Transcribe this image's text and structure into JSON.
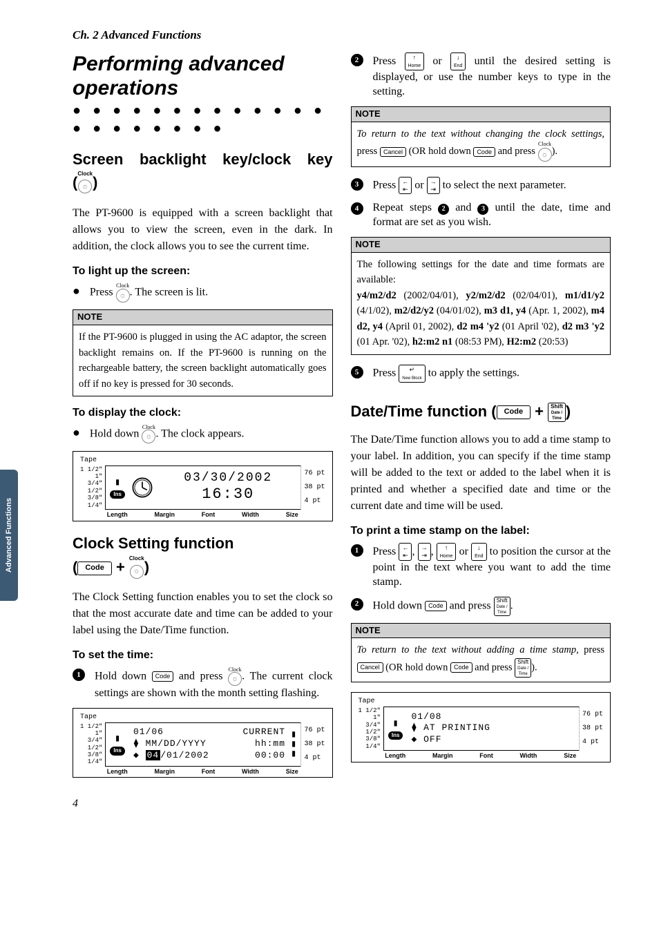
{
  "chapter_header": "Ch. 2 Advanced Functions",
  "side_tab": "Advanced Functions",
  "main_title": "Performing advanced operations",
  "dots": "● ● ● ● ● ● ● ● ● ● ● ● ● ● ● ● ● ● ● ● ●",
  "sec1_title_a": "Screen backlight key/clock key",
  "clock_tiny": "Clock",
  "sec1_body": "The PT-9600 is equipped with a screen back­light that allows you to view the screen, even in the dark. In addition, the clock allows you to see the current time.",
  "sec1_sub1": "To light up the screen:",
  "sec1_sub1_text_a": "Press ",
  "sec1_sub1_text_b": ". The screen is lit.",
  "note_label": "NOTE",
  "note1_body": "If the PT-9600 is plugged in using the AC adaptor, the screen backlight remains on. If the PT-9600 is running on the rechargeable battery, the screen backlight automatically goes off if no key is pressed for 30 seconds.",
  "sec1_sub2": "To display the clock:",
  "sec1_sub2_text_a": "Hold down ",
  "sec1_sub2_text_b": ". The clock appears.",
  "lcd1": {
    "tape": "Tape",
    "left": [
      "1 1/2\"",
      "1\"",
      "3/4\"",
      "1/2\"",
      "3/8\"",
      "1/4\""
    ],
    "date": "03/30/2002",
    "time": "16:30",
    "right": [
      "76 pt",
      "38 pt",
      "4 pt"
    ],
    "bottom": [
      "Length",
      "Margin",
      "Font",
      "Width",
      "Size"
    ],
    "ins": "Ins"
  },
  "sec2_title": "Clock Setting function",
  "sec2_body": "The Clock Setting function enables you to set the clock so that the most accurate date and time can be added to your label using the Date/Time function.",
  "sec2_sub1": "To set the time:",
  "step1a": "Hold down ",
  "step1b": " and press ",
  "step1c": ". The current clock settings are shown with the month setting flashing.",
  "lcd2": {
    "l1": "01/06",
    "l1b": "CURRENT",
    "l2a": "MM/DD/YYYY",
    "l2b": "hh:mm",
    "l3a_pre": "04",
    "l3a": "/01/2002",
    "l3b": "00:00"
  },
  "step2a": "Press ",
  "step2b": " or ",
  "step2c": " until the desired setting is displayed, or use the number keys to type in the setting.",
  "note2a": "To return to the text without changing the clock set­tings",
  "note2b": ", press ",
  "note2c": "(OR hold down ",
  "note2d": "and press ",
  "note2e": ").",
  "step3a": "Press ",
  "step3b": " or ",
  "step3c": " to select the next parameter.",
  "step4a": "Repeat steps ",
  "step4b": " and ",
  "step4c": " until the date, time and format are set as you wish.",
  "note3_intro": "The following settings for the date and time formats are available:",
  "note3_body": "y4/m2/d2 (2002/04/01), y2/m2/d2 (02/04/01), m1/d1/y2 (4/1/02), m2/d2/y2 (04/01/02), m3 d1, y4 (Apr. 1, 2002), m4 d2, y4 (April 01, 2002), d2 m4 'y2 (01 April '02), d2 m3 'y2 (01 Apr. '02), h2:m2 n1 (08:53 PM), H2:m2 (20:53)",
  "step5a": "Press ",
  "step5b": " to apply the settings.",
  "sec3_title": "Date/Time function (",
  "sec3_body": "The Date/Time function allows you to add a time stamp to your label. In addition, you can specify if the time stamp will be added to the text or added to the label when it is printed and whether a specified date and time or the current date and time will be used.",
  "sec3_sub1": "To print a time stamp on the label:",
  "s3step1a": "Press ",
  "s3step1b": ", ",
  "s3step1c": " or ",
  "s3step1d": " to position the cur­sor at the point in the text where you want to add the time stamp.",
  "s3step2a": "Hold down ",
  "s3step2b": " and press ",
  "s3step2c": ".",
  "note4a": "To return to the text without adding a time stamp",
  "note4b": ", press ",
  "note4c": "(OR hold down ",
  "note4d": "and press ",
  "note4e": ").",
  "lcd3": {
    "l1": "01/08",
    "l2": "AT PRINTING",
    "l3": "OFF"
  },
  "keys": {
    "code": "Code",
    "cancel": "Cancel",
    "shift": "Shift",
    "date_time": "Date /\nTime",
    "home": "Home",
    "end": "End",
    "new_block": "New\nBlock",
    "bulb": "💡"
  },
  "page": "4"
}
